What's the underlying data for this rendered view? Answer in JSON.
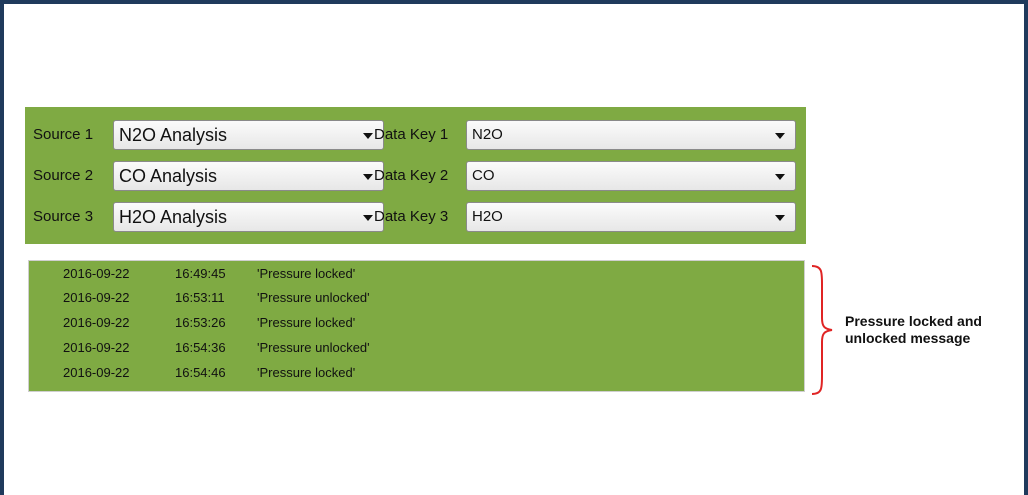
{
  "config": {
    "rows": [
      {
        "source_label": "Source 1",
        "source_value": "N2O Analysis",
        "datakey_label": "Data Key 1",
        "datakey_value": "N2O"
      },
      {
        "source_label": "Source 2",
        "source_value": "CO Analysis",
        "datakey_label": "Data Key 2",
        "datakey_value": "CO"
      },
      {
        "source_label": "Source 3",
        "source_value": "H2O Analysis",
        "datakey_label": "Data Key 3",
        "datakey_value": "H2O"
      }
    ]
  },
  "log": {
    "entries": [
      {
        "date": "2016-09-22",
        "time": "16:49:45",
        "message": "'Pressure locked'"
      },
      {
        "date": "2016-09-22",
        "time": "16:53:11",
        "message": "'Pressure unlocked'"
      },
      {
        "date": "2016-09-22",
        "time": "16:53:26",
        "message": "'Pressure locked'"
      },
      {
        "date": "2016-09-22",
        "time": "16:54:36",
        "message": "'Pressure unlocked'"
      },
      {
        "date": "2016-09-22",
        "time": "16:54:46",
        "message": "'Pressure locked'"
      }
    ]
  },
  "annotation": {
    "line1": "Pressure locked and",
    "line2": "unlocked message"
  },
  "colors": {
    "panel_green": "#7faa43",
    "frame_border": "#1f3a5c",
    "annotation_brace": "#e02424"
  },
  "icons": {
    "dropdown": "chevron-down-icon",
    "brace": "curly-brace-icon"
  }
}
